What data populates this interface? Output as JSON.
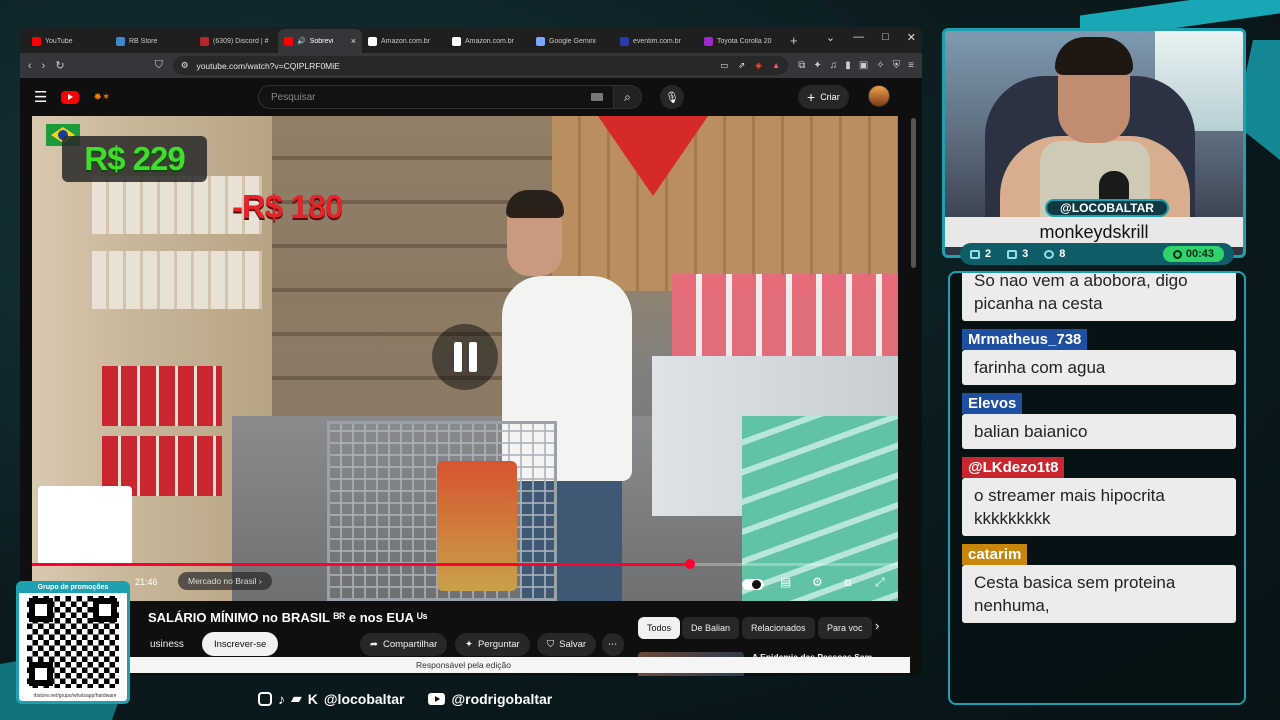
{
  "browser": {
    "tabs": [
      {
        "label": "YouTube",
        "color": "#ff0000",
        "active": false
      },
      {
        "label": "RB Store",
        "color": "#3c89d0",
        "active": false
      },
      {
        "label": "(6309) Discord | #",
        "color": "#b3262b",
        "active": false
      },
      {
        "label": "Sobrevi",
        "color": "#ff0000",
        "active": true
      },
      {
        "label": "Amazon.com.br",
        "color": "#ffffff",
        "active": false
      },
      {
        "label": "Amazon.com.br",
        "color": "#ffffff",
        "active": false
      },
      {
        "label": "Google Gemini",
        "color": "#7aa7ff",
        "active": false
      },
      {
        "label": "eventim.com.br",
        "color": "#2a3aa8",
        "active": false
      },
      {
        "label": "Toyota Corolla 20",
        "color": "#9b2ac6",
        "active": false
      }
    ],
    "url": "youtube.com/watch?v=CQIPLRF0MiE"
  },
  "youtube": {
    "search_placeholder": "Pesquisar",
    "create_label": "Criar",
    "video": {
      "price_main": "R$ 229",
      "price_minus": "-R$ 180",
      "time": "21:46",
      "chapter": "Mercado no Brasil",
      "progress_fraction": 0.76
    },
    "title": "SALÁRIO MÍNIMO no BRASIL ᴮᴿ e nos EUA ᵁˢ",
    "channel_name": "usiness",
    "subscribe_label": "Inscrever-se",
    "actions": {
      "share": "Compartilhar",
      "ask": "Perguntar",
      "save": "Salvar"
    },
    "chips": [
      "Todos",
      "De Balian",
      "Relacionados",
      "Para voc"
    ],
    "rec_title": "A Epidemia das Pessoas Sem",
    "bottom_bar": "Responsável pela edição"
  },
  "overlay": {
    "qr_label": "Grupo de promoções",
    "qr_url": "rbstore.net/grupo/whatsapp/hardware",
    "social_handle_1": "@locobaltar",
    "social_handle_2": "@rodrigobaltar"
  },
  "cam": {
    "handle": "@LOCOBALTAR",
    "name": "monkeydskrill",
    "stats": {
      "chat": "2",
      "youtube": "3",
      "viewers": "8",
      "timer": "00:43"
    }
  },
  "chat": {
    "messages": [
      {
        "user": "",
        "user_color": "",
        "text": "So nao vem a abobora, digo picanha na cesta"
      },
      {
        "user": "Mrmatheus_738",
        "user_color": "#1f4fa0",
        "text": "farinha com agua"
      },
      {
        "user": "Elevos",
        "user_color": "#1f4fa0",
        "text": "balian baianico"
      },
      {
        "user": "@LKdezo1t8",
        "user_color": "#c9262f",
        "text": "o streamer mais hipocrita kkkkkkkkk"
      },
      {
        "user": "catarim",
        "user_color": "#c8860a",
        "text": "Cesta basica sem proteina nenhuma,"
      }
    ]
  }
}
